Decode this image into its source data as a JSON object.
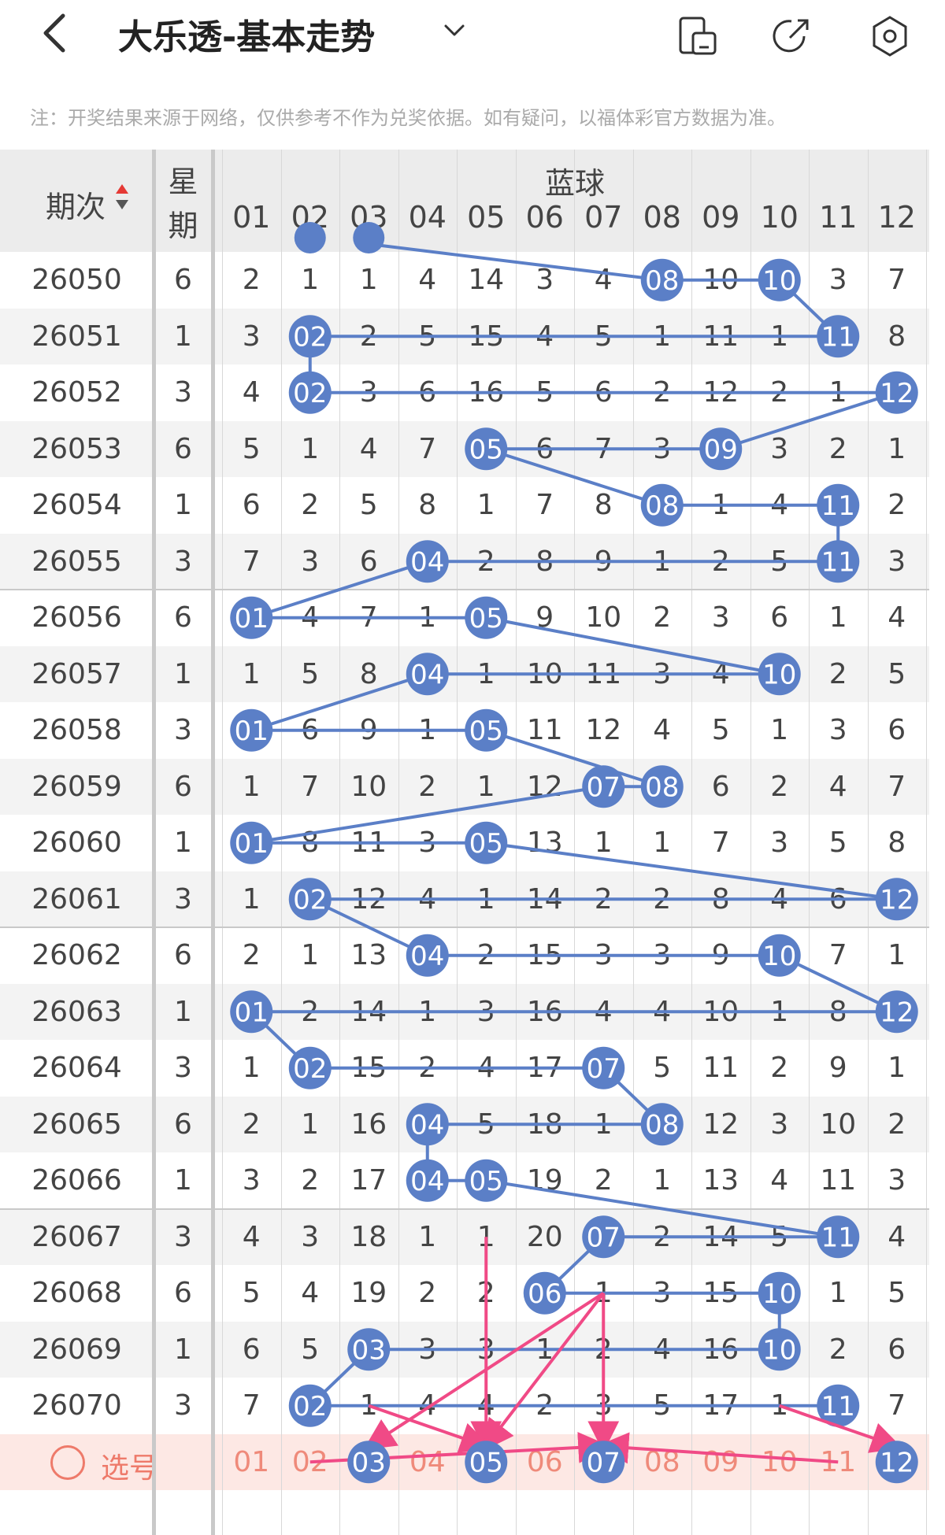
{
  "header": {
    "back_icon": "chevron-left-icon",
    "title": "大乐透-基本走势",
    "dropdown_icon": "chevron-down-icon",
    "actions": [
      {
        "name": "screen-toggle-icon"
      },
      {
        "name": "share-icon"
      },
      {
        "name": "settings-icon"
      }
    ]
  },
  "notice": "注：开奖结果来源于网络，仅供参考不作为兑奖依据。如有疑问，以福体彩官方数据为准。",
  "table": {
    "col_period": "期次",
    "col_week_1": "星",
    "col_week_2": "期",
    "group_label": "蓝球",
    "numbers": [
      "01",
      "02",
      "03",
      "04",
      "05",
      "06",
      "07",
      "08",
      "09",
      "10",
      "11",
      "12"
    ],
    "rows": [
      {
        "period": "26050",
        "week": "6",
        "cells": [
          "2",
          "1",
          "1",
          "4",
          "14",
          "3",
          "4",
          "08",
          "10",
          "10",
          "3",
          "7"
        ],
        "hits": [
          8,
          10
        ]
      },
      {
        "period": "26051",
        "week": "1",
        "cells": [
          "3",
          "02",
          "2",
          "5",
          "15",
          "4",
          "5",
          "1",
          "11",
          "1",
          "11",
          "8"
        ],
        "hits": [
          2,
          11
        ]
      },
      {
        "period": "26052",
        "week": "3",
        "cells": [
          "4",
          "02",
          "3",
          "6",
          "16",
          "5",
          "6",
          "2",
          "12",
          "2",
          "1",
          "12"
        ],
        "hits": [
          2,
          12
        ]
      },
      {
        "period": "26053",
        "week": "6",
        "cells": [
          "5",
          "1",
          "4",
          "7",
          "05",
          "6",
          "7",
          "3",
          "09",
          "3",
          "2",
          "1"
        ],
        "hits": [
          5,
          9
        ]
      },
      {
        "period": "26054",
        "week": "1",
        "cells": [
          "6",
          "2",
          "5",
          "8",
          "1",
          "7",
          "8",
          "08",
          "1",
          "4",
          "11",
          "2"
        ],
        "hits": [
          8,
          11
        ]
      },
      {
        "period": "26055",
        "week": "3",
        "cells": [
          "7",
          "3",
          "6",
          "04",
          "2",
          "8",
          "9",
          "1",
          "2",
          "5",
          "11",
          "3"
        ],
        "hits": [
          4,
          11
        ]
      },
      {
        "period": "26056",
        "week": "6",
        "cells": [
          "01",
          "4",
          "7",
          "1",
          "05",
          "9",
          "10",
          "2",
          "3",
          "6",
          "1",
          "4"
        ],
        "hits": [
          1,
          5
        ]
      },
      {
        "period": "26057",
        "week": "1",
        "cells": [
          "1",
          "5",
          "8",
          "04",
          "1",
          "10",
          "11",
          "3",
          "4",
          "10",
          "2",
          "5"
        ],
        "hits": [
          4,
          10
        ]
      },
      {
        "period": "26058",
        "week": "3",
        "cells": [
          "01",
          "6",
          "9",
          "1",
          "05",
          "11",
          "12",
          "4",
          "5",
          "1",
          "3",
          "6"
        ],
        "hits": [
          1,
          5
        ]
      },
      {
        "period": "26059",
        "week": "6",
        "cells": [
          "1",
          "7",
          "10",
          "2",
          "1",
          "12",
          "07",
          "08",
          "6",
          "2",
          "4",
          "7"
        ],
        "hits": [
          7,
          8
        ]
      },
      {
        "period": "26060",
        "week": "1",
        "cells": [
          "01",
          "8",
          "11",
          "3",
          "05",
          "13",
          "1",
          "1",
          "7",
          "3",
          "5",
          "8"
        ],
        "hits": [
          1,
          5
        ]
      },
      {
        "period": "26061",
        "week": "3",
        "cells": [
          "1",
          "02",
          "12",
          "4",
          "1",
          "14",
          "2",
          "2",
          "8",
          "4",
          "6",
          "12"
        ],
        "hits": [
          2,
          12
        ]
      },
      {
        "period": "26062",
        "week": "6",
        "cells": [
          "2",
          "1",
          "13",
          "04",
          "2",
          "15",
          "3",
          "3",
          "9",
          "10",
          "7",
          "1"
        ],
        "hits": [
          4,
          10
        ]
      },
      {
        "period": "26063",
        "week": "1",
        "cells": [
          "01",
          "2",
          "14",
          "1",
          "3",
          "16",
          "4",
          "4",
          "10",
          "1",
          "8",
          "12"
        ],
        "hits": [
          1,
          12
        ]
      },
      {
        "period": "26064",
        "week": "3",
        "cells": [
          "1",
          "02",
          "15",
          "2",
          "4",
          "17",
          "07",
          "5",
          "11",
          "2",
          "9",
          "1"
        ],
        "hits": [
          2,
          7
        ]
      },
      {
        "period": "26065",
        "week": "6",
        "cells": [
          "2",
          "1",
          "16",
          "04",
          "5",
          "18",
          "1",
          "08",
          "12",
          "3",
          "10",
          "2"
        ],
        "hits": [
          4,
          8
        ]
      },
      {
        "period": "26066",
        "week": "1",
        "cells": [
          "3",
          "2",
          "17",
          "04",
          "05",
          "19",
          "2",
          "1",
          "13",
          "4",
          "11",
          "3"
        ],
        "hits": [
          4,
          5
        ]
      },
      {
        "period": "26067",
        "week": "3",
        "cells": [
          "4",
          "3",
          "18",
          "1",
          "1",
          "20",
          "07",
          "2",
          "14",
          "5",
          "11",
          "4"
        ],
        "hits": [
          7,
          11
        ]
      },
      {
        "period": "26068",
        "week": "6",
        "cells": [
          "5",
          "4",
          "19",
          "2",
          "2",
          "06",
          "1",
          "3",
          "15",
          "10",
          "1",
          "5"
        ],
        "hits": [
          6,
          10
        ]
      },
      {
        "period": "26069",
        "week": "1",
        "cells": [
          "6",
          "5",
          "03",
          "3",
          "3",
          "1",
          "2",
          "4",
          "16",
          "10",
          "2",
          "6"
        ],
        "hits": [
          3,
          10
        ]
      },
      {
        "period": "26070",
        "week": "3",
        "cells": [
          "7",
          "02",
          "1",
          "4",
          "4",
          "2",
          "3",
          "5",
          "17",
          "1",
          "11",
          "7"
        ],
        "hits": [
          2,
          11
        ]
      }
    ],
    "pick_row": {
      "label": "选号",
      "selected": [
        3,
        5,
        7,
        12
      ]
    },
    "pick_row_2_label": "选号"
  },
  "colors": {
    "ball": "#5b7fc7",
    "line": "#5b7fc7",
    "arrow": "#f04a86",
    "pick_text": "#ef8a7a",
    "pick_bg": "#fde8e4"
  },
  "arrows": [
    {
      "from": [
        5,
        17
      ],
      "to": [
        5,
        21
      ]
    },
    {
      "from": [
        7,
        18
      ],
      "to": [
        3,
        21
      ]
    },
    {
      "from": [
        7,
        18
      ],
      "to": [
        5,
        21
      ]
    },
    {
      "from": [
        7,
        18
      ],
      "to": [
        7,
        21
      ]
    },
    {
      "from": [
        3,
        20
      ],
      "to": [
        5,
        21
      ]
    },
    {
      "from": [
        2,
        21
      ],
      "to": [
        7,
        21
      ]
    },
    {
      "from": [
        11,
        21
      ],
      "to": [
        7,
        21
      ]
    },
    {
      "from": [
        10,
        20
      ],
      "to": [
        12,
        21
      ]
    }
  ]
}
